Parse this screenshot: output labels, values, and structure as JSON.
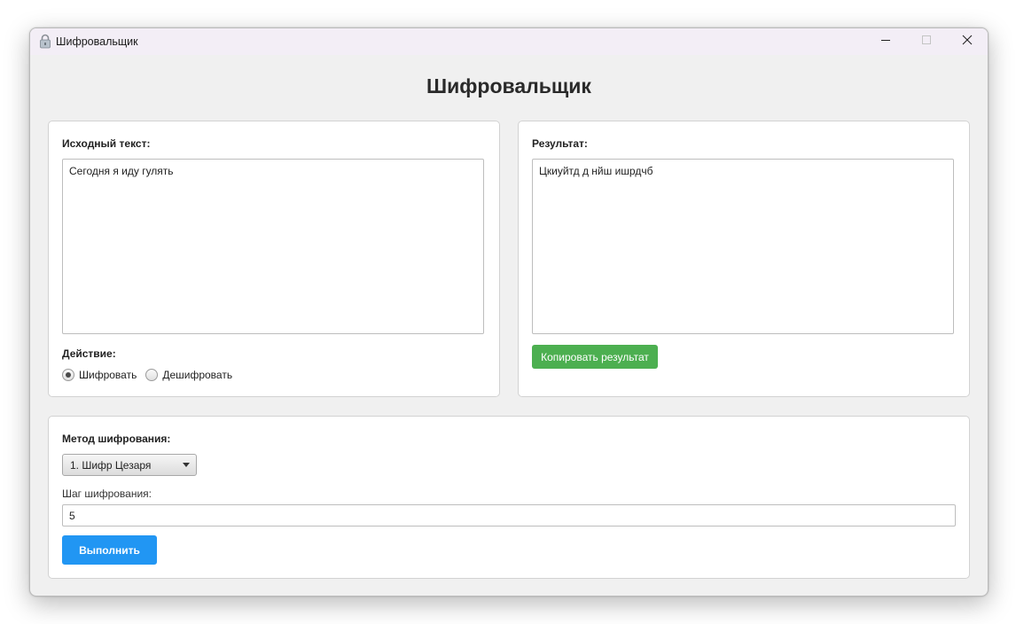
{
  "window": {
    "title": "Шифровальщик",
    "icon": "lock-icon",
    "controls": {
      "minimize": "minimize-icon",
      "maximize": "maximize-icon",
      "close": "close-icon"
    }
  },
  "heading": "Шифровальщик",
  "source": {
    "label": "Исходный текст:",
    "value": "Сегодня я иду гулять"
  },
  "action": {
    "label": "Действие:",
    "options": [
      "Шифровать",
      "Дешифровать"
    ],
    "selected": "Шифровать"
  },
  "result": {
    "label": "Результат:",
    "value": "Цкиуйтд д нйш ишрдчб",
    "copy_button": "Копировать результат"
  },
  "method": {
    "label": "Метод шифрования:",
    "selected": "1. Шифр Цезаря",
    "step_label": "Шаг шифрования:",
    "step_value": "5",
    "execute_button": "Выполнить"
  },
  "colors": {
    "copy_button": "#4caf50",
    "execute_button": "#2196f3",
    "window_bg": "#f0f0f0"
  }
}
